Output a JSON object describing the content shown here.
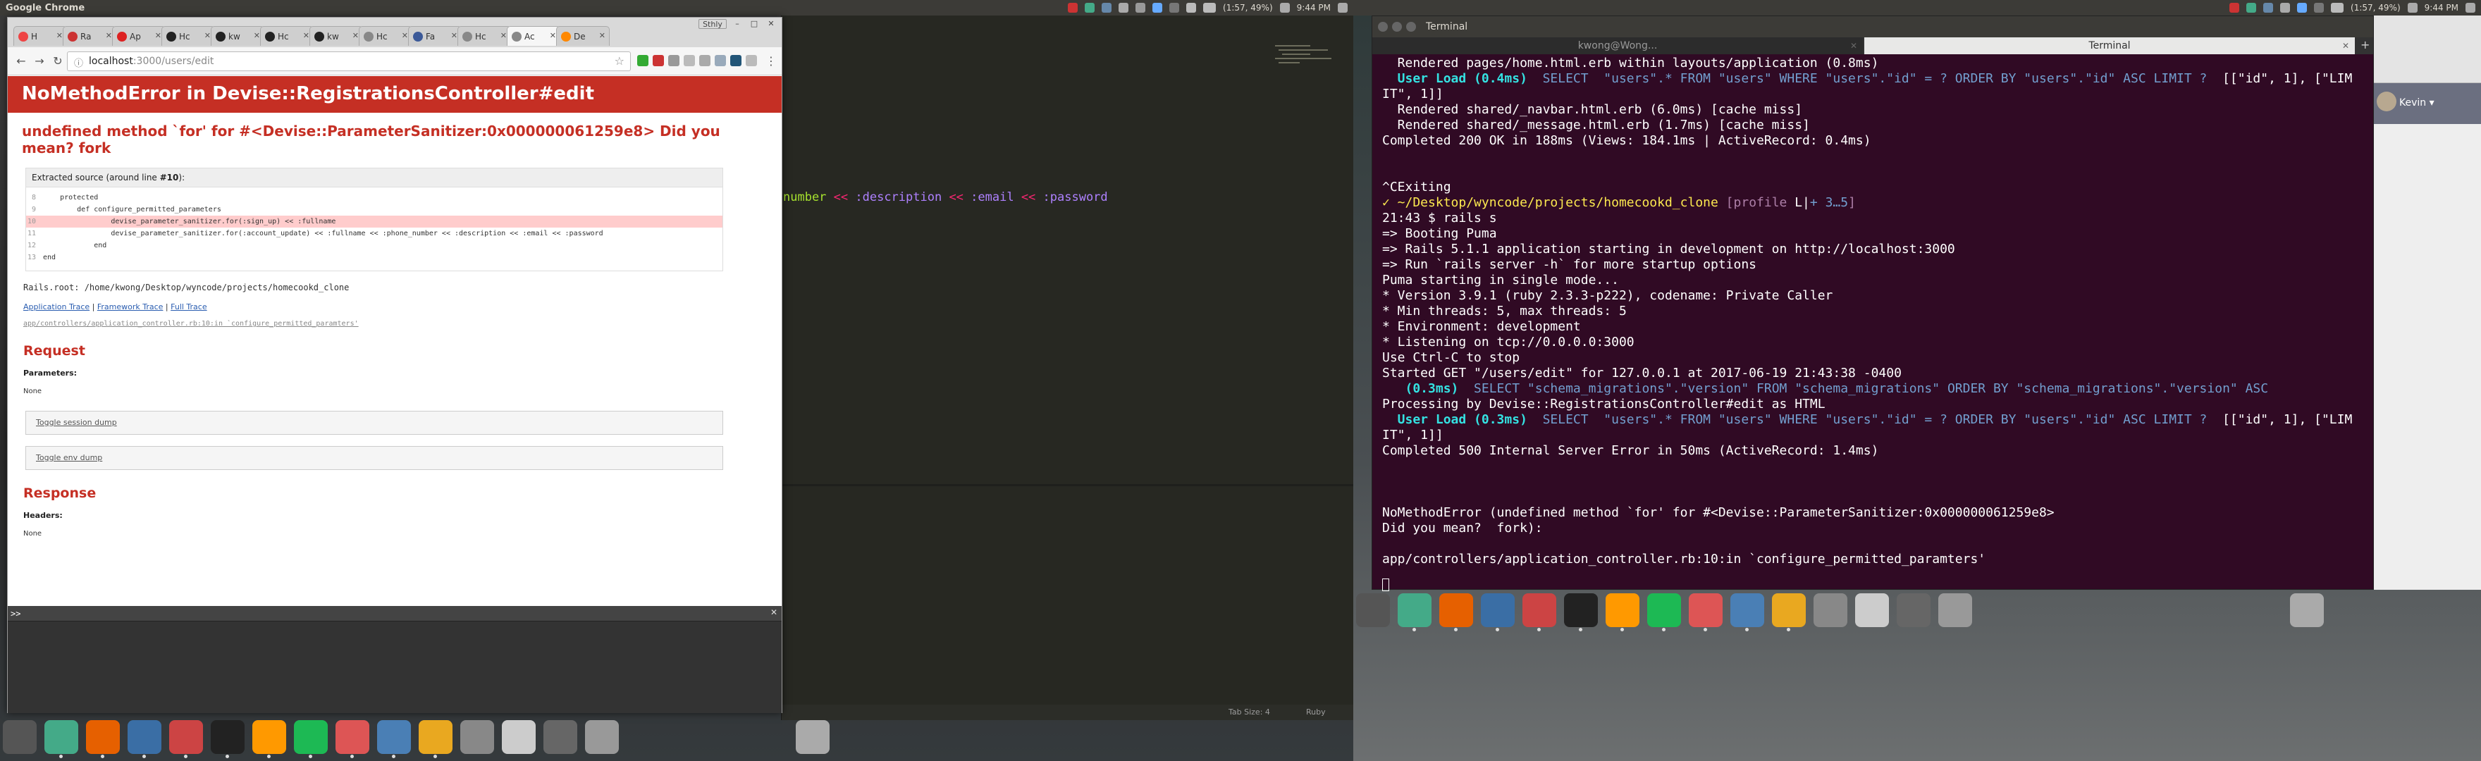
{
  "left_panel": {
    "title": "Google Chrome",
    "battery": "(1:57, 49%)",
    "time": "9:44 PM"
  },
  "right_panel": {
    "battery": "(1:57, 49%)",
    "time": "9:44 PM"
  },
  "chrome": {
    "tabs": [
      {
        "label": "H",
        "color": "#e44"
      },
      {
        "label": "Ra",
        "color": "#c33"
      },
      {
        "label": "Ap",
        "color": "#d22"
      },
      {
        "label": "Hc",
        "color": "#222"
      },
      {
        "label": "kw",
        "color": "#222"
      },
      {
        "label": "Hc",
        "color": "#222"
      },
      {
        "label": "kw",
        "color": "#222"
      },
      {
        "label": "Hc",
        "color": "#888"
      },
      {
        "label": "Fa",
        "color": "#3b5998"
      },
      {
        "label": "Hc",
        "color": "#888"
      },
      {
        "label": "Ac",
        "color": "#888",
        "active": true
      },
      {
        "label": "De",
        "color": "#f80"
      }
    ],
    "profile_label": "Sthly",
    "url_host": "localhost",
    "url_path": ":3000/users/edit"
  },
  "error_page": {
    "header": "NoMethodError in Devise::RegistrationsController#edit",
    "message": "undefined method `for' for #<Devise::ParameterSanitizer:0x000000061259e8> Did you mean? fork",
    "source_header_prefix": "Extracted source (around line ",
    "source_header_line": "#10",
    "source_header_suffix": "):",
    "source_lines": [
      {
        "n": "8",
        "text": "    protected"
      },
      {
        "n": "9",
        "text": "        def configure_permitted_parameters"
      },
      {
        "n": "10",
        "text": "                devise_parameter_sanitizer.for(:sign_up) << :fullname",
        "hl": true
      },
      {
        "n": "11",
        "text": "                devise_parameter_sanitizer.for(:account_update) << :fullname << :phone_number << :description << :email << :password"
      },
      {
        "n": "12",
        "text": "            end"
      },
      {
        "n": "13",
        "text": "end"
      }
    ],
    "rails_root": "Rails.root: /home/kwong/Desktop/wyncode/projects/homecookd_clone",
    "trace_links": [
      "Application Trace",
      "Framework Trace",
      "Full Trace"
    ],
    "trace_line": "app/controllers/application_controller.rb:10:in `configure_permitted_paramters'",
    "request_heading": "Request",
    "parameters_label": "Parameters",
    "parameters_value": "None",
    "toggle_session": "Toggle session dump",
    "toggle_env": "Toggle env dump",
    "response_heading": "Response",
    "headers_label": "Headers",
    "headers_value": "None",
    "console_prompt": ">>"
  },
  "editor": {
    "code_tokens": [
      {
        "t": "number",
        "c": "#a6e22e"
      },
      {
        "t": " << ",
        "c": "#f92672"
      },
      {
        "t": ":description",
        "c": "#ae81ff"
      },
      {
        "t": " << ",
        "c": "#f92672"
      },
      {
        "t": ":email",
        "c": "#ae81ff"
      },
      {
        "t": " << ",
        "c": "#f92672"
      },
      {
        "t": ":password",
        "c": "#ae81ff"
      }
    ],
    "tab_size": "Tab Size: 4",
    "syntax": "Ruby"
  },
  "terminal": {
    "title": "Terminal",
    "tabs": [
      "kwong@Wong...",
      "Terminal"
    ],
    "lines": [
      [
        {
          "t": "  Rendered pages/home.html.erb within layouts/application (0.8ms)"
        }
      ],
      [
        {
          "t": "  User Load (0.4ms)",
          "c": "c-cy"
        },
        {
          "t": "  SELECT  \"users\".* FROM \"users\" WHERE \"users\".\"id\" = ? ORDER BY \"users\".\"id\" ASC LIMIT ?",
          "c": "c-bl"
        },
        {
          "t": "  [[\"id\", 1], [\"LIM"
        }
      ],
      [
        {
          "t": "IT\", 1]]"
        }
      ],
      [
        {
          "t": "  Rendered shared/_navbar.html.erb (6.0ms) [cache miss]"
        }
      ],
      [
        {
          "t": "  Rendered shared/_message.html.erb (1.7ms) [cache miss]"
        }
      ],
      [
        {
          "t": "Completed 200 OK in 188ms (Views: 184.1ms | ActiveRecord: 0.4ms)"
        }
      ],
      [
        {
          "t": ""
        }
      ],
      [
        {
          "t": ""
        }
      ],
      [
        {
          "t": "^CExiting"
        }
      ],
      [
        {
          "t": "✓ ~/Desktop/wyncode/projects/homecookd_clone ",
          "c": "c-ye"
        },
        {
          "t": "[",
          "c": "c-mg"
        },
        {
          "t": "profile ",
          "c": "c-mg"
        },
        {
          "t": "L|",
          "c": ""
        },
        {
          "t": "+ 3…5",
          "c": "c-bl"
        },
        {
          "t": "]",
          "c": "c-mg"
        }
      ],
      [
        {
          "t": "21:43 $ rails s"
        }
      ],
      [
        {
          "t": "=> Booting Puma"
        }
      ],
      [
        {
          "t": "=> Rails 5.1.1 application starting in development on http://localhost:3000"
        }
      ],
      [
        {
          "t": "=> Run `rails server -h` for more startup options"
        }
      ],
      [
        {
          "t": "Puma starting in single mode..."
        }
      ],
      [
        {
          "t": "* Version 3.9.1 (ruby 2.3.3-p222), codename: Private Caller"
        }
      ],
      [
        {
          "t": "* Min threads: 5, max threads: 5"
        }
      ],
      [
        {
          "t": "* Environment: development"
        }
      ],
      [
        {
          "t": "* Listening on tcp://0.0.0.0:3000"
        }
      ],
      [
        {
          "t": "Use Ctrl-C to stop"
        }
      ],
      [
        {
          "t": "Started GET \"/users/edit\" for 127.0.0.1 at 2017-06-19 21:43:38 -0400"
        }
      ],
      [
        {
          "t": "   (0.3ms)",
          "c": "c-cy"
        },
        {
          "t": "  SELECT \"schema_migrations\".\"version\" FROM \"schema_migrations\" ORDER BY \"schema_migrations\".\"version\" ASC",
          "c": "c-bl"
        }
      ],
      [
        {
          "t": "Processing by Devise::RegistrationsController#edit as HTML"
        }
      ],
      [
        {
          "t": "  User Load (0.3ms)",
          "c": "c-cy"
        },
        {
          "t": "  SELECT  \"users\".* FROM \"users\" WHERE \"users\".\"id\" = ? ORDER BY \"users\".\"id\" ASC LIMIT ?",
          "c": "c-bl"
        },
        {
          "t": "  [[\"id\", 1], [\"LIM"
        }
      ],
      [
        {
          "t": "IT\", 1]]"
        }
      ],
      [
        {
          "t": "Completed 500 Internal Server Error in 50ms (ActiveRecord: 1.4ms)"
        }
      ],
      [
        {
          "t": ""
        }
      ],
      [
        {
          "t": ""
        }
      ],
      [
        {
          "t": ""
        }
      ],
      [
        {
          "t": "NoMethodError (undefined method `for' for #<Devise::ParameterSanitizer:0x000000061259e8>"
        }
      ],
      [
        {
          "t": "Did you mean?  fork):"
        }
      ],
      [
        {
          "t": ""
        }
      ],
      [
        {
          "t": "app/controllers/application_controller.rb:10:in `configure_permitted_paramters'"
        }
      ]
    ]
  },
  "right_chrome": {
    "user_name": "Kevin"
  },
  "launcher_apps": [
    {
      "name": "dash",
      "color": "#555"
    },
    {
      "name": "chrome",
      "color": "#4a8"
    },
    {
      "name": "firefox",
      "color": "#e66000"
    },
    {
      "name": "files",
      "color": "#3a6ea5"
    },
    {
      "name": "settings",
      "color": "#c44"
    },
    {
      "name": "terminal",
      "color": "#222"
    },
    {
      "name": "sublime",
      "color": "#f90"
    },
    {
      "name": "spotify",
      "color": "#1db954"
    },
    {
      "name": "calendar",
      "color": "#d55"
    },
    {
      "name": "thunderbird",
      "color": "#4a7fb5"
    },
    {
      "name": "slack",
      "color": "#e9a820"
    },
    {
      "name": "scanner",
      "color": "#888"
    },
    {
      "name": "text-editor",
      "color": "#ccc"
    },
    {
      "name": "workspaces",
      "color": "#666"
    },
    {
      "name": "drive",
      "color": "#999"
    }
  ]
}
